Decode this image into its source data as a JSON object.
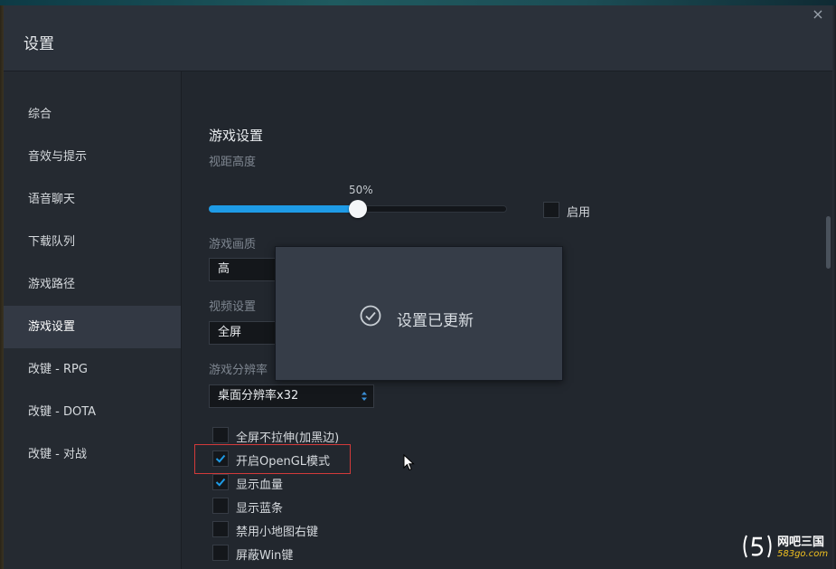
{
  "window": {
    "title": "设置",
    "close_glyph": "×"
  },
  "sidebar": {
    "items": [
      {
        "label": "综合"
      },
      {
        "label": "音效与提示"
      },
      {
        "label": "语音聊天"
      },
      {
        "label": "下载队列"
      },
      {
        "label": "游戏路径"
      },
      {
        "label": "游戏设置",
        "active": true
      },
      {
        "label": "改键 - RPG"
      },
      {
        "label": "改键 - DOTA"
      },
      {
        "label": "改键 - 对战"
      }
    ]
  },
  "game_settings": {
    "section_title": "游戏设置",
    "view_height": {
      "label": "视距高度",
      "value_text": "50%",
      "value": 0.5,
      "enable_label": "启用",
      "enabled": false
    },
    "quality": {
      "label": "游戏画质",
      "selected": "高"
    },
    "video": {
      "label": "视频设置",
      "selected": "全屏"
    },
    "resolution": {
      "label": "游戏分辨率",
      "selected": "桌面分辨率x32"
    },
    "options": [
      {
        "label": "全屏不拉伸(加黑边)",
        "checked": false
      },
      {
        "label": "开启OpenGL模式",
        "checked": true
      },
      {
        "label": "显示血量",
        "checked": true
      },
      {
        "label": "显示蓝条",
        "checked": false
      },
      {
        "label": "禁用小地图右键",
        "checked": false
      },
      {
        "label": "屏蔽Win键",
        "checked": false
      }
    ]
  },
  "toast": {
    "message": "设置已更新"
  },
  "watermark": {
    "name": "网吧三国",
    "site": "583go.com"
  },
  "colors": {
    "accent": "#1e9be6",
    "highlight": "#d33a3a"
  }
}
